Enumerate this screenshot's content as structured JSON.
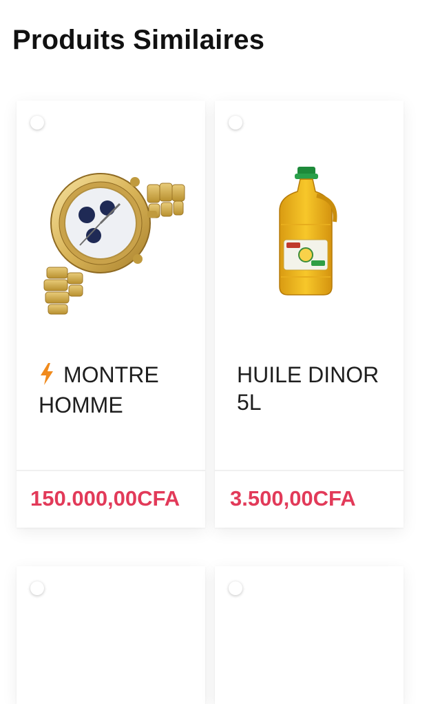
{
  "section": {
    "title": "Produits Similaires"
  },
  "products": [
    {
      "name": "MONTRE HOMME",
      "price": "150.000,00CFA",
      "badge_icon": "lightning-bolt-icon",
      "image": "gold-wristwatch"
    },
    {
      "name": "HUILE DINOR 5L",
      "price": "3.500,00CFA",
      "image": "cooking-oil-bottle"
    },
    {
      "name": "",
      "price": ""
    },
    {
      "name": "",
      "price": ""
    }
  ],
  "colors": {
    "price": "#e23a59",
    "flash_icon": "#f08a1c",
    "title": "#111111"
  }
}
